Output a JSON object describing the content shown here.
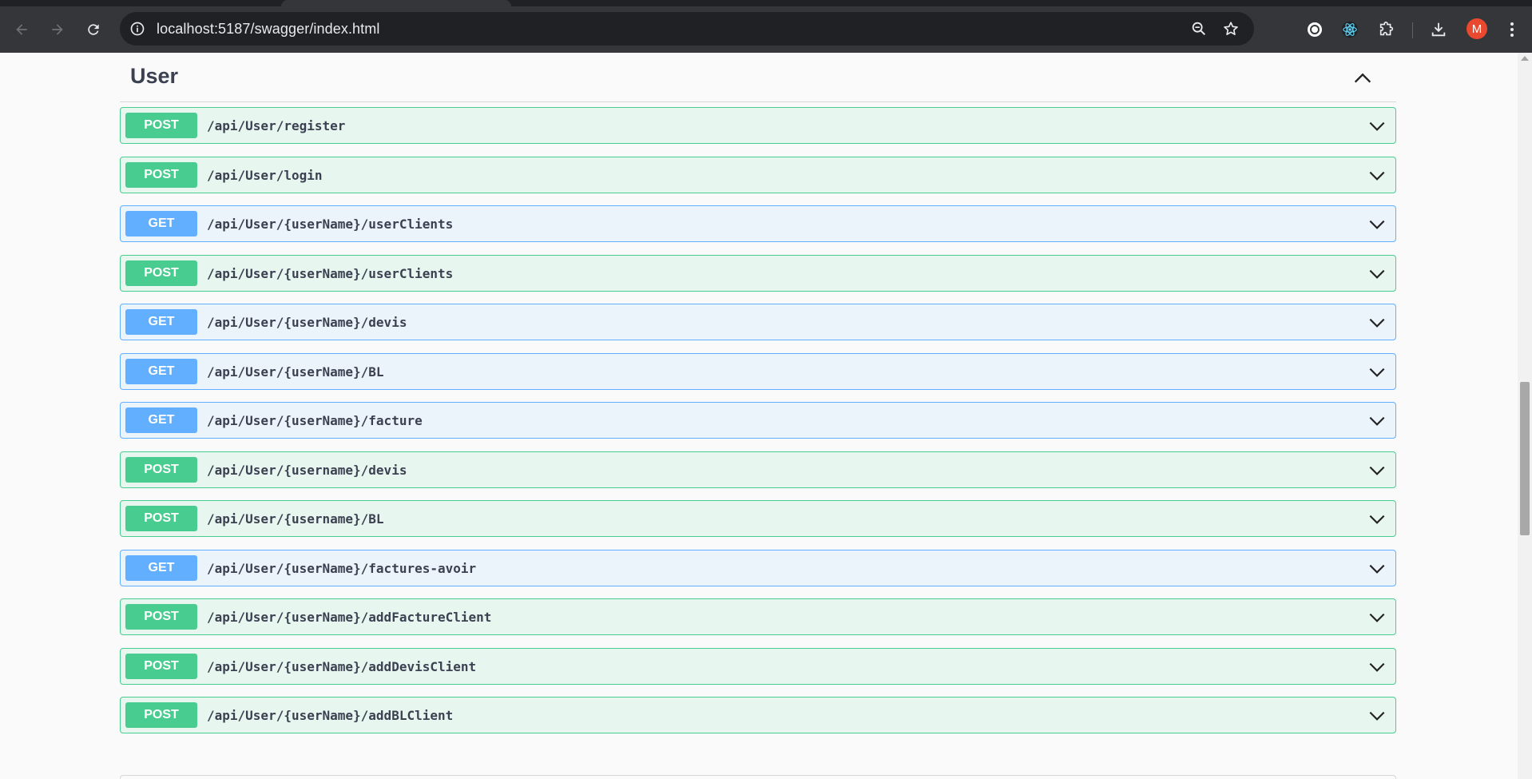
{
  "browser": {
    "url": "localhost:5187/swagger/index.html",
    "avatar_letter": "M",
    "icons": [
      "back-icon",
      "forward-icon",
      "reload-icon",
      "site-info-icon",
      "zoom-icon",
      "bookmark-star-icon",
      "extension-circle-icon",
      "react-devtools-icon",
      "extensions-puzzle-icon",
      "download-icon",
      "menu-kebab-icon"
    ]
  },
  "section": {
    "title": "User",
    "expanded": true
  },
  "colors": {
    "post": "#49cc90",
    "get": "#61affe"
  },
  "operations": [
    {
      "method": "POST",
      "path": "/api/User/register"
    },
    {
      "method": "POST",
      "path": "/api/User/login"
    },
    {
      "method": "GET",
      "path": "/api/User/{userName}/userClients"
    },
    {
      "method": "POST",
      "path": "/api/User/{userName}/userClients"
    },
    {
      "method": "GET",
      "path": "/api/User/{userName}/devis"
    },
    {
      "method": "GET",
      "path": "/api/User/{userName}/BL"
    },
    {
      "method": "GET",
      "path": "/api/User/{userName}/facture"
    },
    {
      "method": "POST",
      "path": "/api/User/{username}/devis"
    },
    {
      "method": "POST",
      "path": "/api/User/{username}/BL"
    },
    {
      "method": "GET",
      "path": "/api/User/{userName}/factures-avoir"
    },
    {
      "method": "POST",
      "path": "/api/User/{userName}/addFactureClient"
    },
    {
      "method": "POST",
      "path": "/api/User/{userName}/addDevisClient"
    },
    {
      "method": "POST",
      "path": "/api/User/{userName}/addBLClient"
    }
  ]
}
